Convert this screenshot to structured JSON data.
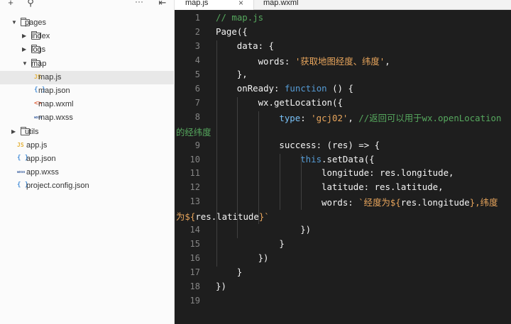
{
  "sidebar": {
    "toolbar": {
      "add_icon": "+",
      "search_icon": "⚲",
      "more_icon": "···",
      "collapse_icon": "⇤"
    },
    "tree": [
      {
        "name": "pages",
        "type": "folder",
        "expanded": true,
        "depth": 0
      },
      {
        "name": "index",
        "type": "folder",
        "expanded": false,
        "depth": 1
      },
      {
        "name": "logs",
        "type": "folder",
        "expanded": false,
        "depth": 1
      },
      {
        "name": "map",
        "type": "folder",
        "expanded": true,
        "depth": 1
      },
      {
        "name": "map.js",
        "type": "js",
        "depth": 2,
        "selected": true
      },
      {
        "name": "map.json",
        "type": "json",
        "depth": 2
      },
      {
        "name": "map.wxml",
        "type": "wxml",
        "depth": 2
      },
      {
        "name": "map.wxss",
        "type": "wxss",
        "depth": 2
      },
      {
        "name": "utils",
        "type": "folder",
        "expanded": false,
        "depth": 0
      },
      {
        "name": "app.js",
        "type": "js",
        "depth": 0
      },
      {
        "name": "app.json",
        "type": "json",
        "depth": 0
      },
      {
        "name": "app.wxss",
        "type": "wxss",
        "depth": 0
      },
      {
        "name": "project.config.json",
        "type": "json",
        "depth": 0
      }
    ],
    "file_icon_text": {
      "js": "JS",
      "json": "{ }",
      "wxml": "<>",
      "wxss": "wxss"
    }
  },
  "editor": {
    "tabs": [
      {
        "label": "map.js",
        "active": true,
        "close": "×"
      },
      {
        "label": "map.wxml",
        "active": false
      }
    ],
    "lines": [
      {
        "num": "1",
        "indent": 0,
        "tokens": [
          [
            "cm",
            "// map.js"
          ]
        ]
      },
      {
        "num": "2",
        "indent": 0,
        "tokens": [
          [
            "plain",
            "Page({"
          ]
        ]
      },
      {
        "num": "3",
        "indent": 1,
        "tokens": [
          [
            "plain",
            "data: {"
          ]
        ]
      },
      {
        "num": "4",
        "indent": 2,
        "tokens": [
          [
            "plain",
            "words: "
          ],
          [
            "str",
            "'获取地图经度、纬度'"
          ],
          [
            "plain",
            ","
          ]
        ]
      },
      {
        "num": "5",
        "indent": 1,
        "tokens": [
          [
            "plain",
            "},"
          ]
        ]
      },
      {
        "num": "6",
        "indent": 1,
        "tokens": [
          [
            "plain",
            "onReady: "
          ],
          [
            "kw",
            "function"
          ],
          [
            "plain",
            " () {"
          ]
        ]
      },
      {
        "num": "7",
        "indent": 2,
        "tokens": [
          [
            "plain",
            "wx.getLocation({"
          ]
        ]
      },
      {
        "num": "8",
        "indent": 3,
        "tokens": [
          [
            "prop",
            "type"
          ],
          [
            "plain",
            ": "
          ],
          [
            "str",
            "'gcj02'"
          ],
          [
            "plain",
            ", "
          ],
          [
            "cm",
            "//返回可以用于wx.openLocation"
          ]
        ]
      },
      {
        "num": "",
        "indent": -1,
        "tokens": [
          [
            "cm",
            "的经纬度"
          ]
        ]
      },
      {
        "num": "9",
        "indent": 3,
        "tokens": [
          [
            "plain",
            "success: (res) => {"
          ]
        ]
      },
      {
        "num": "10",
        "indent": 4,
        "tokens": [
          [
            "kw",
            "this"
          ],
          [
            "plain",
            ".setData({"
          ]
        ]
      },
      {
        "num": "11",
        "indent": 5,
        "tokens": [
          [
            "plain",
            "longitude: res.longitude,"
          ]
        ]
      },
      {
        "num": "12",
        "indent": 5,
        "tokens": [
          [
            "plain",
            "latitude: res.latitude,"
          ]
        ]
      },
      {
        "num": "13",
        "indent": 5,
        "tokens": [
          [
            "plain",
            "words: "
          ],
          [
            "str",
            "`经度为${"
          ],
          [
            "plain",
            "res.longitude"
          ],
          [
            "str",
            "},纬度"
          ]
        ]
      },
      {
        "num": "",
        "indent": -1,
        "tokens": [
          [
            "str",
            "为${"
          ],
          [
            "plain",
            "res.latitude"
          ],
          [
            "str",
            "}`"
          ]
        ]
      },
      {
        "num": "14",
        "indent": 4,
        "tokens": [
          [
            "plain",
            "})"
          ]
        ]
      },
      {
        "num": "15",
        "indent": 3,
        "tokens": [
          [
            "plain",
            "}"
          ]
        ]
      },
      {
        "num": "16",
        "indent": 2,
        "tokens": [
          [
            "plain",
            "})"
          ]
        ]
      },
      {
        "num": "17",
        "indent": 1,
        "tokens": [
          [
            "plain",
            "}"
          ]
        ]
      },
      {
        "num": "18",
        "indent": 0,
        "tokens": [
          [
            "plain",
            "})"
          ]
        ]
      },
      {
        "num": "19",
        "indent": 0,
        "tokens": []
      }
    ]
  }
}
